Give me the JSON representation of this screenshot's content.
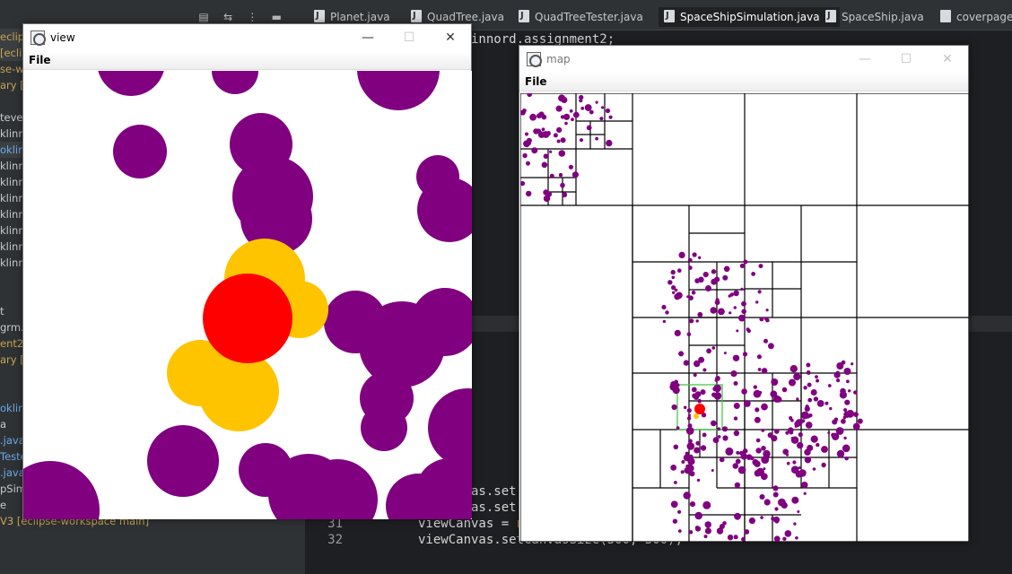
{
  "explorer": {
    "rows": [
      {
        "text": "eclips",
        "tone": "yellow",
        "strip": true
      },
      {
        "text": "[eclips",
        "tone": "yellow",
        "strip": true
      },
      {
        "text": "se-wo",
        "tone": "yellow",
        "strip": false
      },
      {
        "text": "ary [J",
        "tone": "yellow",
        "strip": false
      },
      {
        "text": "",
        "tone": "",
        "strip": false
      },
      {
        "text": "tever",
        "tone": "",
        "strip": false
      },
      {
        "text": "klinnc",
        "tone": "",
        "strip": false
      },
      {
        "text": "oklin",
        "tone": "blue",
        "strip": true
      },
      {
        "text": "klinnc",
        "tone": "",
        "strip": false
      },
      {
        "text": "klinnc",
        "tone": "",
        "strip": false
      },
      {
        "text": "klinnc",
        "tone": "",
        "strip": false
      },
      {
        "text": "klinnc",
        "tone": "",
        "strip": false
      },
      {
        "text": "klinnc",
        "tone": "",
        "strip": false
      },
      {
        "text": "klinnc",
        "tone": "",
        "strip": false
      },
      {
        "text": "klinnc",
        "tone": "",
        "strip": false
      },
      {
        "text": "",
        "tone": "",
        "strip": false
      },
      {
        "text": "",
        "tone": "",
        "strip": false
      },
      {
        "text": "t",
        "tone": "",
        "strip": false
      },
      {
        "text": "grm.t",
        "tone": "",
        "strip": false
      },
      {
        "text": "ent2 [",
        "tone": "yellow",
        "strip": false
      },
      {
        "text": "ary [J",
        "tone": "yellow",
        "strip": false
      },
      {
        "text": "",
        "tone": "",
        "strip": false
      },
      {
        "text": "",
        "tone": "",
        "strip": false
      },
      {
        "text": "oklin",
        "tone": "blue",
        "strip": false
      },
      {
        "text": "a",
        "tone": "",
        "strip": false
      },
      {
        "text": ".java",
        "tone": "blue",
        "strip": false
      },
      {
        "text": "Teste",
        "tone": "blue",
        "strip": false
      },
      {
        "text": ".java",
        "tone": "blue",
        "strip": false
      },
      {
        "text": "pSimu",
        "tone": "",
        "strip": false
      },
      {
        "text": "e",
        "tone": "",
        "strip": false
      },
      {
        "text": "V3 [eclipse-workspace main]",
        "tone": "yellow",
        "strip": false
      }
    ]
  },
  "tabs": [
    {
      "label": "Planet.java",
      "active": false,
      "kind": "java"
    },
    {
      "label": "QuadTree.java",
      "active": false,
      "kind": "java"
    },
    {
      "label": "QuadTreeTester.java",
      "active": false,
      "kind": "java"
    },
    {
      "label": "SpaceShipSimulation.java",
      "active": true,
      "kind": "java"
    },
    {
      "label": "SpaceShip.java",
      "active": false,
      "kind": "java"
    },
    {
      "label": "coverpage",
      "active": false,
      "kind": "doc"
    }
  ],
  "code_lines": [
    {
      "num": "",
      "segments": [
        {
          "text": "cs.loklinnord.assignment2;",
          "cls": ""
        }
      ]
    },
    {
      "num": "",
      "segments": [
        {
          "text": "t.Color",
          "cls": ""
        }
      ]
    },
    {
      "num": "",
      "segments": [
        {
          "text": "t.Recta",
          "cls": ""
        }
      ]
    },
    {
      "num": "",
      "segments": [
        {
          "text": "l.Arra",
          "cls": ""
        }
      ]
    },
    {
      "num": "",
      "segments": [
        {
          "text": "l.List",
          "cls": ""
        }
      ]
    },
    {
      "num": "",
      "segments": [
        {
          "text": "",
          "cls": ""
        }
      ]
    },
    {
      "num": "",
      "segments": [
        {
          "text": "ludraw.",
          "cls": ""
        }
      ]
    },
    {
      "num": "",
      "segments": [
        {
          "text": "ludraw.",
          "cls": ""
        }
      ]
    },
    {
      "num": "",
      "segments": [
        {
          "text": "",
          "cls": ""
        }
      ]
    },
    {
      "num": "",
      "segments": [
        {
          "text": "aceShi",
          "cls": "ident"
        }
      ]
    },
    {
      "num": "",
      "segments": [
        {
          "text": "QT te",
          "cls": "tp"
        }
      ]
    },
    {
      "num": "",
      "segments": [
        {
          "text": "tic voi",
          "cls": "kw"
        }
      ]
    },
    {
      "num": "",
      "segments": [
        {
          "text": "ceShip",
          "cls": "ident"
        }
      ]
    },
    {
      "num": "",
      "segments": [
        {
          "text": "",
          "cls": ""
        }
      ]
    },
    {
      "num": "",
      "segments": [
        {
          "text": "riable",
          "cls": "tp"
        }
      ]
    },
    {
      "num": "",
      "segments": [
        {
          "text": "dTree",
          "cls": "ident"
        }
      ]
    },
    {
      "num": "",
      "segments": [
        {
          "text": "t<Plan",
          "cls": "ident"
        }
      ]
    },
    {
      "num": "",
      "segments": [
        {
          "text": "lean e",
          "cls": "kw"
        }
      ]
    },
    {
      "num": "",
      "segments": [
        {
          "text": "w mapC",
          "cls": "ident"
        }
      ]
    },
    {
      "num": "",
      "segments": [
        {
          "text": "w view",
          "cls": "ident"
        }
      ]
    },
    {
      "num": "",
      "segments": [
        {
          "text": "ceShip",
          "cls": "ident"
        }
      ]
    },
    {
      "num": "",
      "segments": [
        {
          "text": " chang",
          "cls": ""
        }
      ]
    },
    {
      "num": "",
      "segments": [
        {
          "text": " chang",
          "cls": ""
        }
      ]
    },
    {
      "num": "",
      "segments": [
        {
          "text": "ctor. s",
          "cls": "tp"
        }
      ]
    },
    {
      "num": "",
      "segments": [
        {
          "text": "eShipS",
          "cls": "ident"
        }
      ]
    },
    {
      "num": "",
      "segments": [
        {
          "text": "vas = n",
          "cls": ""
        }
      ]
    },
    {
      "num": "",
      "segments": [
        {
          "text": "vas.set",
          "cls": ""
        }
      ]
    },
    {
      "num": "",
      "segments": [
        {
          "text": "vas.ena",
          "cls": ""
        }
      ]
    },
    {
      "num": "",
      "segments": [
        {
          "text": "mapCanvas.set",
          "cls": ""
        }
      ]
    },
    {
      "num": "30",
      "segments": [
        {
          "text": "mapCanvas.set",
          "cls": ""
        }
      ]
    },
    {
      "num": "31",
      "segments": [
        {
          "text": "viewCanvas = ",
          "cls": ""
        },
        {
          "text": "new",
          "cls": "kw"
        },
        {
          "text": " Draw(",
          "cls": ""
        },
        {
          "text": "\"view\"",
          "cls": "str"
        },
        {
          "text": ");",
          "cls": ""
        }
      ]
    },
    {
      "num": "32",
      "segments": [
        {
          "text": "viewCanvas.setCanvasSize(500, 500);",
          "cls": ""
        }
      ]
    }
  ],
  "view_window": {
    "title": "view",
    "menu": "File",
    "controls": {
      "minimize": "—",
      "maximize": "☐",
      "close": "✕"
    }
  },
  "map_window": {
    "title": "map",
    "menu": "File",
    "controls": {
      "minimize": "—",
      "maximize": "☐",
      "close": "✕"
    }
  },
  "colors": {
    "planet": "#800080",
    "ship_a": "#ffc400",
    "ship_b": "#ffc400",
    "player_ship": "#ff0000",
    "viewport_box": "#44cc44",
    "quadtree_line": "#000000"
  }
}
